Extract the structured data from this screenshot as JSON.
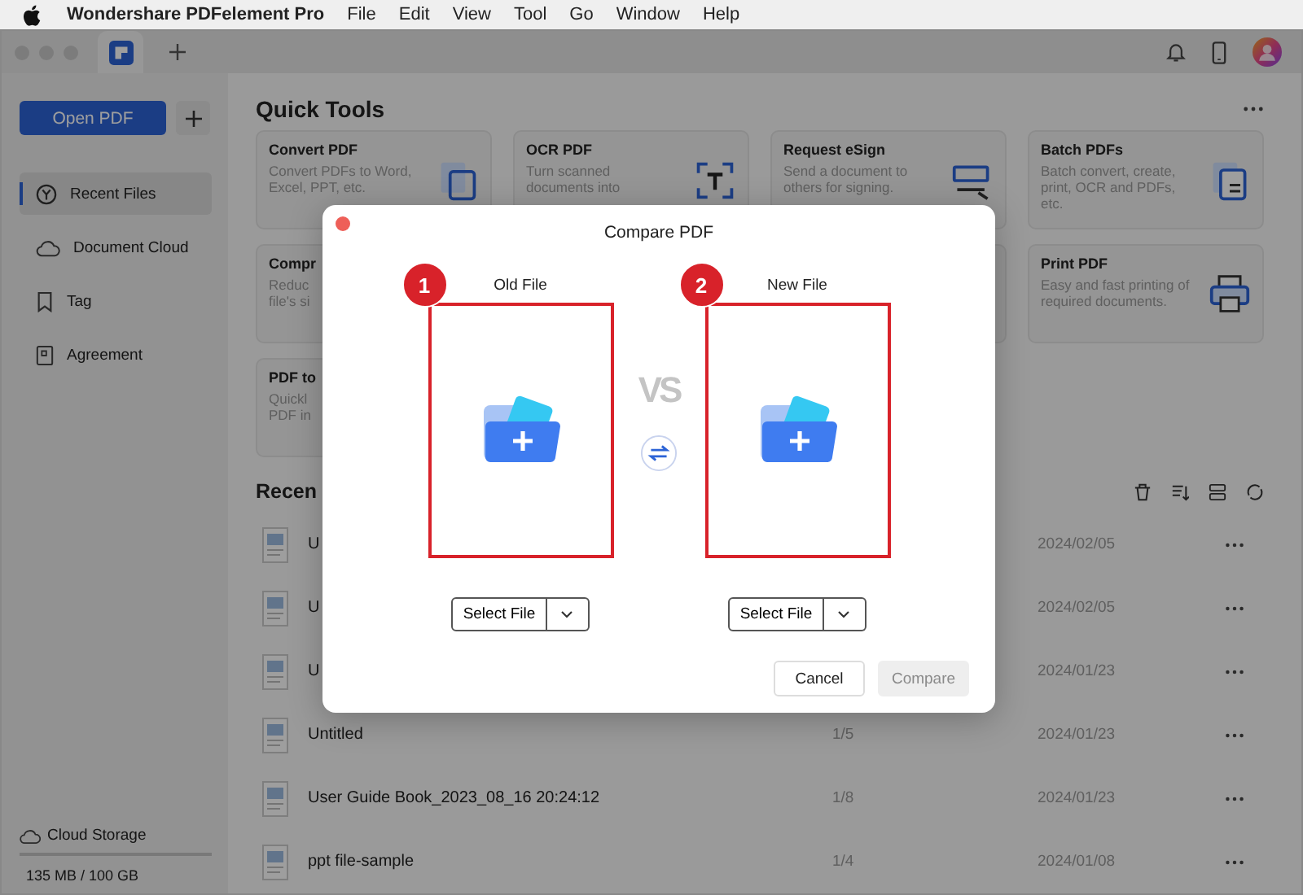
{
  "menubar": {
    "app_name": "Wondershare PDFelement Pro",
    "menus": [
      "File",
      "Edit",
      "View",
      "Tool",
      "Go",
      "Window",
      "Help"
    ]
  },
  "sidebar": {
    "open_button": "Open PDF",
    "items": [
      {
        "label": "Recent Files",
        "selected": true
      },
      {
        "label": "Document Cloud",
        "selected": false
      },
      {
        "label": "Tag",
        "selected": false
      },
      {
        "label": "Agreement",
        "selected": false
      }
    ],
    "storage": {
      "label": "Cloud Storage",
      "usage": "135 MB / 100 GB"
    }
  },
  "quick_tools": {
    "title": "Quick Tools",
    "cards": [
      {
        "title": "Convert PDF",
        "lines": [
          "Convert PDFs to Word,",
          "Excel, PPT, etc."
        ]
      },
      {
        "title": "OCR PDF",
        "lines": [
          "Turn scanned",
          "documents into"
        ]
      },
      {
        "title": "Request eSign",
        "lines": [
          "Send a document to",
          "others for signing."
        ]
      },
      {
        "title": "Batch PDFs",
        "lines": [
          "Batch convert, create,",
          "print, OCR and PDFs,",
          "etc."
        ]
      },
      {
        "title": "Compr",
        "lines": [
          "Reduc",
          "file's si"
        ]
      },
      {
        "title": "Print PDF",
        "lines": [
          "Easy and fast printing of",
          "required documents."
        ]
      },
      {
        "title": "PDF to",
        "lines": [
          "Quickl",
          "PDF in"
        ]
      }
    ]
  },
  "recent": {
    "title": "Recen",
    "files": [
      {
        "name": "U",
        "date": "2024/02/05"
      },
      {
        "name": "U",
        "date": "2024/02/05"
      },
      {
        "name": "U",
        "date": "2024/01/23"
      },
      {
        "name": "Untitled",
        "pages": "1/5",
        "date": "2024/01/23"
      },
      {
        "name": "User Guide Book_2023_08_16 20:24:12",
        "pages": "1/8",
        "date": "2024/01/23"
      },
      {
        "name": "ppt file-sample",
        "pages": "1/4",
        "date": "2024/01/08"
      }
    ]
  },
  "dialog": {
    "title": "Compare PDF",
    "vs": "VS",
    "slots": [
      {
        "number": "1",
        "label": "Old File",
        "button": "Select File"
      },
      {
        "number": "2",
        "label": "New File",
        "button": "Select File"
      }
    ],
    "buttons": [
      {
        "label": "Cancel",
        "disabled": false
      },
      {
        "label": "Compare",
        "disabled": true
      }
    ]
  }
}
